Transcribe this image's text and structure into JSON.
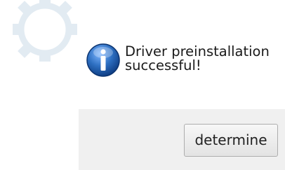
{
  "dialog": {
    "icon": "info-icon",
    "message_line1": "Driver preinstallation",
    "message_line2": "successful!",
    "button_label": "determine"
  },
  "colors": {
    "icon_blue": "#2d6fc1",
    "footer_bg": "#f0f0f0",
    "watermark": "#7fa6c6"
  }
}
